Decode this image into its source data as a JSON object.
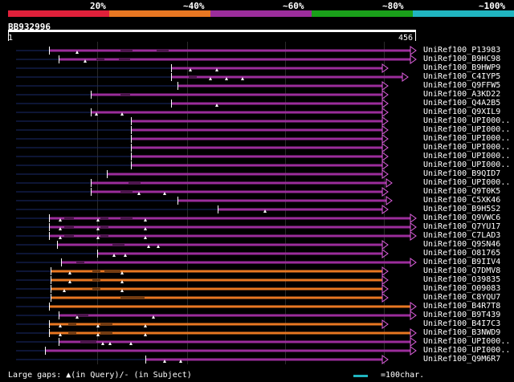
{
  "colors": {
    "band": [
      "#e0203a",
      "#e87722",
      "#9b2d9b",
      "#1aa01a",
      "#20b5c0"
    ],
    "purple": "#9b2d9b",
    "orange": "#e87722",
    "thin": "#1a2a6a",
    "arrow": "#e060e0",
    "scale": "#20b5c0"
  },
  "color_legend": [
    "20%",
    "~40%",
    "~60%",
    "~80%",
    "~100%"
  ],
  "query_title": "BB932996",
  "ruler": {
    "start": "1",
    "end": "456"
  },
  "hits": [
    {
      "id": "UniRef100_P13983",
      "color": "purple",
      "start": 61,
      "end": 518,
      "thin": [
        [
          20,
          61
        ]
      ],
      "gaps": [
        [
          150,
          165
        ],
        [
          195,
          210
        ]
      ],
      "q": [
        96
      ],
      "s": []
    },
    {
      "id": "UniRef100_B9HC98",
      "color": "purple",
      "start": 73,
      "end": 518,
      "thin": [
        [
          20,
          73
        ]
      ],
      "gaps": [
        [
          120,
          130
        ],
        [
          148,
          162
        ]
      ],
      "q": [
        106
      ],
      "s": []
    },
    {
      "id": "UniRef100_B9HWP9",
      "color": "purple",
      "start": 213,
      "end": 483,
      "thin": [
        [
          20,
          213
        ]
      ],
      "gaps": [],
      "q": [
        237,
        270
      ],
      "s": []
    },
    {
      "id": "UniRef100_C4IYP5",
      "color": "purple",
      "start": 213,
      "end": 508,
      "thin": [
        [
          20,
          213
        ]
      ],
      "gaps": [
        [
          235,
          245
        ]
      ],
      "q": [
        262,
        282,
        302
      ],
      "s": []
    },
    {
      "id": "UniRef100_Q9FFW5",
      "color": "purple",
      "start": 221,
      "end": 483,
      "thin": [
        [
          20,
          221
        ]
      ],
      "gaps": [],
      "q": [],
      "s": []
    },
    {
      "id": "UniRef100_A3KD22",
      "color": "purple",
      "start": 113,
      "end": 483,
      "thin": [
        [
          20,
          113
        ]
      ],
      "gaps": [
        [
          150,
          162
        ]
      ],
      "q": [],
      "s": []
    },
    {
      "id": "UniRef100_Q4A2B5",
      "color": "purple",
      "start": 213,
      "end": 483,
      "thin": [
        [
          20,
          213
        ]
      ],
      "gaps": [],
      "q": [
        270
      ],
      "s": []
    },
    {
      "id": "UniRef100_Q9XIL9",
      "color": "purple",
      "start": 113,
      "end": 483,
      "thin": [
        [
          20,
          113
        ]
      ],
      "gaps": [],
      "q": [
        120,
        152
      ],
      "s": []
    },
    {
      "id": "UniRef100_UPI000..",
      "color": "purple",
      "start": 163,
      "end": 483,
      "thin": [
        [
          20,
          163
        ]
      ],
      "gaps": [],
      "q": [],
      "s": []
    },
    {
      "id": "UniRef100_UPI000..",
      "color": "purple",
      "start": 163,
      "end": 483,
      "thin": [
        [
          20,
          163
        ]
      ],
      "gaps": [],
      "q": [],
      "s": []
    },
    {
      "id": "UniRef100_UPI000..",
      "color": "purple",
      "start": 163,
      "end": 483,
      "thin": [
        [
          20,
          163
        ]
      ],
      "gaps": [],
      "q": [],
      "s": []
    },
    {
      "id": "UniRef100_UPI000..",
      "color": "purple",
      "start": 163,
      "end": 483,
      "thin": [
        [
          20,
          163
        ]
      ],
      "gaps": [],
      "q": [],
      "s": []
    },
    {
      "id": "UniRef100_UPI000..",
      "color": "purple",
      "start": 163,
      "end": 483,
      "thin": [
        [
          20,
          163
        ]
      ],
      "gaps": [],
      "q": [],
      "s": []
    },
    {
      "id": "UniRef100_UPI000..",
      "color": "purple",
      "start": 163,
      "end": 483,
      "thin": [
        [
          20,
          163
        ]
      ],
      "gaps": [],
      "q": [],
      "s": []
    },
    {
      "id": "UniRef100_B9QID7",
      "color": "purple",
      "start": 133,
      "end": 483,
      "thin": [
        [
          20,
          133
        ]
      ],
      "gaps": [],
      "q": [],
      "s": []
    },
    {
      "id": "UniRef100_UPI000..",
      "color": "purple",
      "start": 113,
      "end": 488,
      "thin": [
        [
          20,
          113
        ]
      ],
      "gaps": [
        [
          160,
          175
        ]
      ],
      "q": [],
      "s": []
    },
    {
      "id": "UniRef100_Q9T0K5",
      "color": "purple",
      "start": 113,
      "end": 483,
      "thin": [
        [
          20,
          113
        ]
      ],
      "gaps": [
        [
          150,
          165
        ]
      ],
      "q": [
        173,
        205
      ],
      "s": []
    },
    {
      "id": "UniRef100_C5XK46",
      "color": "purple",
      "start": 221,
      "end": 488,
      "thin": [
        [
          20,
          221
        ]
      ],
      "gaps": [],
      "q": [],
      "s": []
    },
    {
      "id": "UniRef100_B9H5S2",
      "color": "purple",
      "start": 271,
      "end": 483,
      "thin": [
        [
          20,
          271
        ]
      ],
      "gaps": [],
      "q": [
        330
      ],
      "s": []
    },
    {
      "id": "UniRef100_Q9VWC6",
      "color": "purple",
      "start": 61,
      "end": 518,
      "thin": [
        [
          20,
          61
        ]
      ],
      "gaps": [
        [
          80,
          92
        ],
        [
          125,
          135
        ],
        [
          150,
          165
        ]
      ],
      "q": [
        75,
        122,
        181
      ],
      "s": []
    },
    {
      "id": "UniRef100_Q7YU17",
      "color": "purple",
      "start": 61,
      "end": 518,
      "thin": [
        [
          20,
          61
        ]
      ],
      "gaps": [
        [
          80,
          92
        ],
        [
          125,
          135
        ]
      ],
      "q": [
        75,
        122,
        181
      ],
      "s": []
    },
    {
      "id": "UniRef100_C7LAD3",
      "color": "purple",
      "start": 61,
      "end": 518,
      "thin": [
        [
          20,
          61
        ]
      ],
      "gaps": [
        [
          80,
          92
        ],
        [
          125,
          135
        ]
      ],
      "q": [
        75,
        122,
        181
      ],
      "s": []
    },
    {
      "id": "UniRef100_Q9SN46",
      "color": "purple",
      "start": 71,
      "end": 483,
      "thin": [
        [
          20,
          71
        ]
      ],
      "gaps": [
        [
          140,
          155
        ]
      ],
      "q": [
        185,
        197
      ],
      "s": []
    },
    {
      "id": "UniRef100_O81765",
      "color": "purple",
      "start": 121,
      "end": 483,
      "thin": [
        [
          20,
          121
        ]
      ],
      "gaps": [],
      "q": [
        142,
        156
      ],
      "s": []
    },
    {
      "id": "UniRef100_B9IIV4",
      "color": "purple",
      "start": 76,
      "end": 518,
      "thin": [
        [
          20,
          76
        ]
      ],
      "gaps": [
        [
          95,
          105
        ]
      ],
      "q": [],
      "s": []
    },
    {
      "id": "UniRef100_Q7DMV8",
      "color": "orange",
      "start": 63,
      "end": 483,
      "thin": [
        [
          20,
          63
        ]
      ],
      "gaps": [
        [
          115,
          125
        ],
        [
          130,
          150
        ]
      ],
      "q": [
        87,
        152
      ],
      "s": []
    },
    {
      "id": "UniRef100_O39835",
      "color": "orange",
      "start": 63,
      "end": 483,
      "thin": [
        [
          20,
          63
        ]
      ],
      "gaps": [
        [
          115,
          125
        ]
      ],
      "q": [
        87,
        152
      ],
      "s": []
    },
    {
      "id": "UniRef100_O09083",
      "color": "orange",
      "start": 63,
      "end": 483,
      "thin": [
        [
          20,
          63
        ]
      ],
      "gaps": [
        [
          115,
          125
        ]
      ],
      "q": [
        80,
        152
      ],
      "s": []
    },
    {
      "id": "UniRef100_C8YQU7",
      "color": "orange",
      "start": 63,
      "end": 483,
      "thin": [
        [
          20,
          63
        ]
      ],
      "gaps": [
        [
          150,
          180
        ]
      ],
      "q": [],
      "s": []
    },
    {
      "id": "UniRef100_B4R7T8",
      "color": "orange",
      "start": 61,
      "end": 518,
      "thin": [
        [
          20,
          61
        ]
      ],
      "gaps": [],
      "q": [],
      "s": []
    },
    {
      "id": "UniRef100_B9T439",
      "color": "purple",
      "start": 73,
      "end": 518,
      "thin": [
        [
          20,
          73
        ]
      ],
      "gaps": [
        [
          95,
          110
        ]
      ],
      "q": [
        96,
        191
      ],
      "s": []
    },
    {
      "id": "UniRef100_B4I7C3",
      "color": "orange",
      "start": 61,
      "end": 483,
      "thin": [
        [
          20,
          61
        ]
      ],
      "gaps": [
        [
          85,
          95
        ],
        [
          125,
          140
        ]
      ],
      "q": [
        75,
        122,
        181
      ],
      "s": []
    },
    {
      "id": "UniRef100_B3NWD9",
      "color": "orange",
      "start": 61,
      "end": 518,
      "thin": [
        [
          20,
          61
        ]
      ],
      "gaps": [
        [
          85,
          95
        ],
        [
          125,
          140
        ]
      ],
      "q": [
        75,
        122,
        181
      ],
      "s": []
    },
    {
      "id": "UniRef100_UPI000..",
      "color": "purple",
      "start": 73,
      "end": 518,
      "thin": [
        [
          20,
          73
        ]
      ],
      "gaps": [
        [
          100,
          120
        ]
      ],
      "q": [
        128,
        137,
        163
      ],
      "s": []
    },
    {
      "id": "UniRef100_UPI000..",
      "color": "purple",
      "start": 56,
      "end": 518,
      "thin": [
        [
          20,
          56
        ]
      ],
      "gaps": [],
      "q": [],
      "s": []
    },
    {
      "id": "UniRef100_Q9M6R7",
      "color": "purple",
      "start": 181,
      "end": 483,
      "thin": [
        [
          20,
          181
        ]
      ],
      "gaps": [],
      "q": [
        205,
        225
      ],
      "s": []
    }
  ],
  "legend_text": "Large gaps: ▲(in Query)/- (in Subject)",
  "scale_text": "=100char."
}
